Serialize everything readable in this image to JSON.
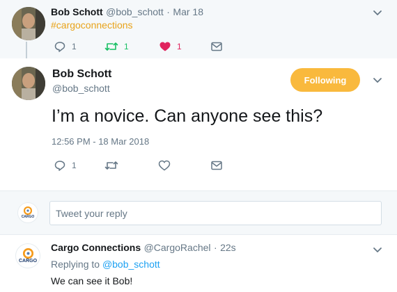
{
  "parent_tweet": {
    "name": "Bob Schott",
    "handle": "@bob_schott",
    "separator": "·",
    "date": "Mar 18",
    "hashtag": "#cargoconnections",
    "reply_count": "1",
    "retweet_count": "1",
    "like_count": "1"
  },
  "main_tweet": {
    "name": "Bob Schott",
    "handle": "@bob_schott",
    "follow_label": "Following",
    "text": "I’m a novice. Can anyone see this?",
    "timestamp": "12:56 PM - 18 Mar 2018",
    "reply_count": "1"
  },
  "reply_box": {
    "placeholder": "Tweet your reply",
    "avatar_text": "CARGO"
  },
  "reply_tweet": {
    "name": "Cargo Connections",
    "handle": "@CargoRachel",
    "separator": "·",
    "time": "22s",
    "replying_prefix": "Replying to",
    "replying_to": "@bob_schott",
    "text": "We can see it Bob!",
    "avatar_text": "CARGO"
  },
  "colors": {
    "accent_follow": "#f9b93d",
    "retweet_green": "#17bf63",
    "like_red": "#e0245e",
    "link_blue": "#1da1f2"
  }
}
